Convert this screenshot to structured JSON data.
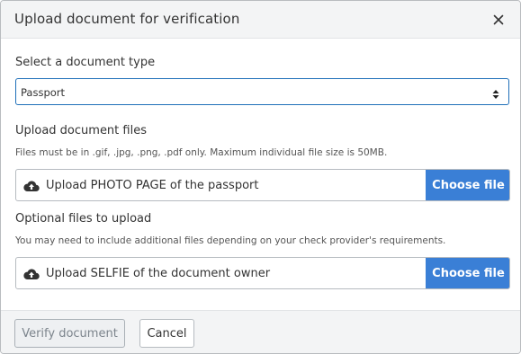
{
  "dialog": {
    "title": "Upload document for verification",
    "close_icon": "close-icon"
  },
  "document_type": {
    "label": "Select a document type",
    "selected": "Passport"
  },
  "files": {
    "label": "Upload document files",
    "hint": "Files must be in .gif, .jpg, .png, .pdf only. Maximum individual file size is 50MB.",
    "primary_upload": {
      "icon": "cloud-upload-icon",
      "label": "Upload PHOTO PAGE of the passport",
      "button": "Choose file"
    }
  },
  "optional_files": {
    "label": "Optional files to upload",
    "hint": "You may need to include additional files depending on your check provider's requirements.",
    "selfie_upload": {
      "icon": "cloud-upload-icon",
      "label": "Upload SELFIE of the document owner",
      "button": "Choose file"
    }
  },
  "footer": {
    "verify_label": "Verify document",
    "cancel_label": "Cancel"
  },
  "colors": {
    "accent": "#3a7fd6",
    "focus_border": "#1f6fb9",
    "header_bg": "#f3f4f5"
  }
}
